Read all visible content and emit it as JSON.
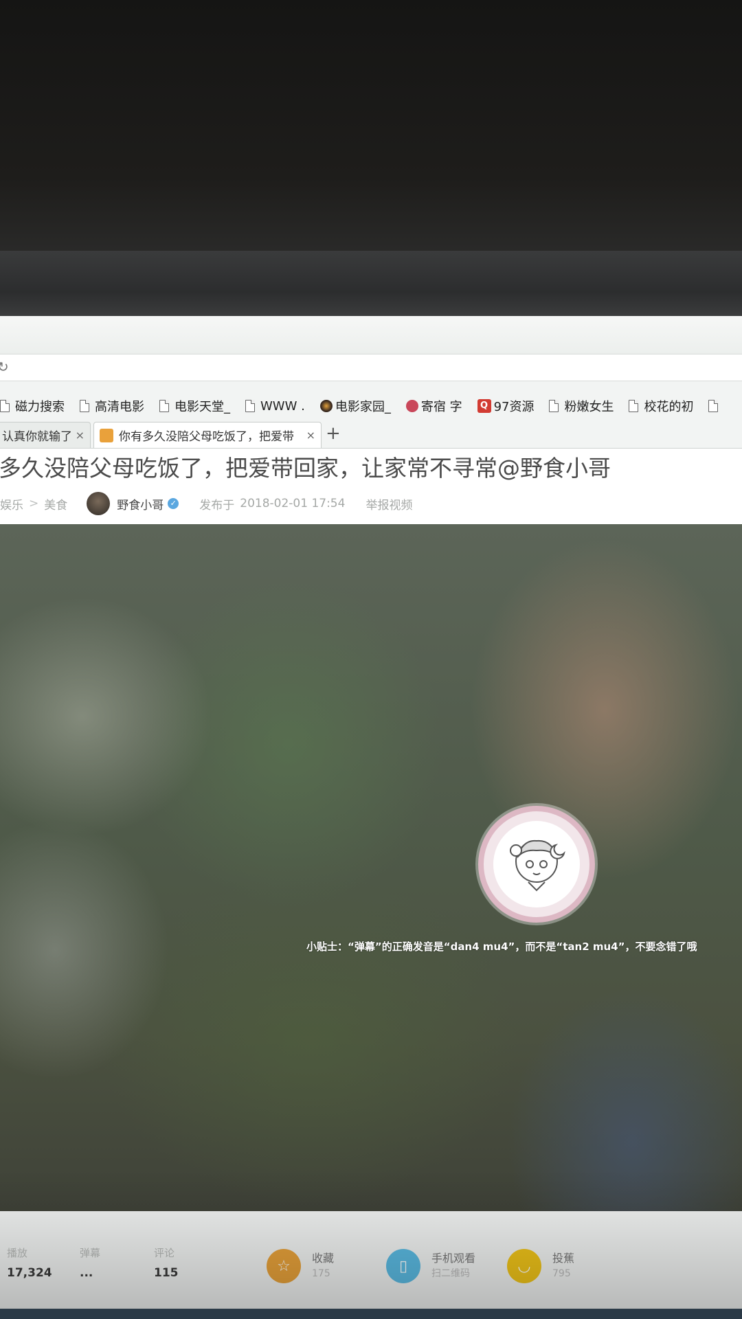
{
  "bookmarks": [
    {
      "label": "磁力搜索",
      "icon": "page-icon"
    },
    {
      "label": "高清电影",
      "icon": "page-icon"
    },
    {
      "label": "电影天堂_",
      "icon": "page-icon"
    },
    {
      "label": "WWW .",
      "icon": "page-icon"
    },
    {
      "label": "电影家园_",
      "icon": "film-home-icon"
    },
    {
      "label": "寄宿 字",
      "icon": "jisu-icon"
    },
    {
      "label": "97资源",
      "icon": "q-icon",
      "icon_text": "Q"
    },
    {
      "label": "粉嫩女生",
      "icon": "page-icon"
    },
    {
      "label": "校花的初",
      "icon": "page-icon"
    }
  ],
  "tabs": [
    {
      "title": "认真你就输了",
      "close": "×"
    },
    {
      "title": "你有多久没陪父母吃饭了，把爱带",
      "close": "×"
    }
  ],
  "new_tab": "+",
  "page": {
    "title": "多久没陪父母吃饭了，把爱带回家，让家常不寻常@野食小哥",
    "breadcrumb": [
      "娱乐",
      "美食"
    ],
    "breadcrumb_sep": ">",
    "author": "野食小哥",
    "verified_mark": "✓",
    "published_label": "发布于",
    "published_at": "2018-02-01  17:54",
    "report": "举报视频"
  },
  "player": {
    "tip": "小贴士：“弹幕”的正确发音是“dan4 mu4”，而不是“tan2 mu4”，不要念错了哦"
  },
  "stats": {
    "plays_label": "播放",
    "plays_value": "17,324",
    "danmaku_label": "弹幕",
    "danmaku_value": "...",
    "likes_label": "评论",
    "likes_value": "115"
  },
  "actions": [
    {
      "label": "收藏",
      "sub": "175",
      "icon": "star-icon",
      "color": "#e8a23a"
    },
    {
      "label": "手机观看",
      "sub": "扫二维码",
      "icon": "phone-icon",
      "color": "#5bbbe3"
    },
    {
      "label": "投蕉",
      "sub": "795",
      "icon": "banana-icon",
      "color": "#f0c419"
    }
  ]
}
